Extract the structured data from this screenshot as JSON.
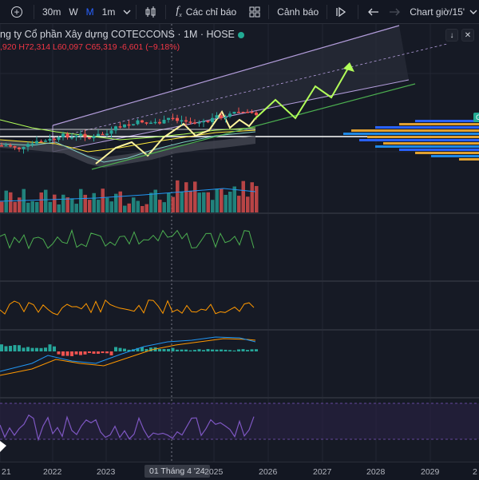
{
  "toolbar": {
    "intervals": [
      "30m",
      "W",
      "M",
      "1m"
    ],
    "active_interval": "M",
    "indicators_label": "Các chỉ báo",
    "alerts_label": "Cảnh báo",
    "chart_name_label": "Chart giờ/15'"
  },
  "legend": {
    "title": "ng ty Cổ phần Xây dựng COTECCONS · 1M · HOSE",
    "open": ",920",
    "high": "H72,314",
    "low": "L60,097",
    "close": "C65,319",
    "change": "-6,601 (−9.18%)"
  },
  "xaxis": {
    "labels": [
      "21",
      "2022",
      "2023",
      "2025",
      "2026",
      "2027",
      "2028",
      "2029",
      "2"
    ],
    "selected_label": "01 Tháng 4 '24"
  },
  "side_badge": "G",
  "colors": {
    "up": "#26a69a",
    "down": "#ef5350",
    "accent": "#2962ff",
    "channel": "#b39ddb",
    "projection": "#b2ff59"
  }
}
